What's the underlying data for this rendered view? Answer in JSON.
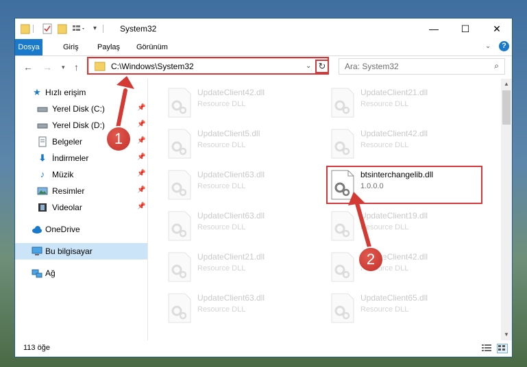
{
  "window": {
    "title": "System32"
  },
  "window_controls": {
    "minimize": "—",
    "maximize": "☐",
    "close": "✕"
  },
  "ribbon": {
    "tabs": [
      "Dosya",
      "Giriş",
      "Paylaş",
      "Görünüm"
    ]
  },
  "address": {
    "path": "C:\\Windows\\System32",
    "refresh": "↻"
  },
  "search": {
    "placeholder": "Ara: System32"
  },
  "sidebar": {
    "items": [
      {
        "label": "Hızlı erişim"
      },
      {
        "label": "Yerel Disk (C:)"
      },
      {
        "label": "Yerel Disk (D:)"
      },
      {
        "label": "Belgeler"
      },
      {
        "label": "İndirmeler"
      },
      {
        "label": "Müzik"
      },
      {
        "label": "Resimler"
      },
      {
        "label": "Videolar"
      },
      {
        "label": "OneDrive"
      },
      {
        "label": "Bu bilgisayar"
      },
      {
        "label": "Ağ"
      }
    ]
  },
  "files": [
    {
      "name": "UpdateClient42.dll",
      "desc": "Resource DLL"
    },
    {
      "name": "UpdateClient21.dll",
      "desc": "Resource DLL"
    },
    {
      "name": "UpdateClient5.dll",
      "desc": "Resource DLL"
    },
    {
      "name": "UpdateClient42.dll",
      "desc": "Resource DLL"
    },
    {
      "name": "UpdateClient63.dll",
      "desc": "Resource DLL"
    },
    {
      "name": "btsinterchangelib.dll",
      "desc": "1.0.0.0"
    },
    {
      "name": "UpdateClient63.dll",
      "desc": "Resource DLL"
    },
    {
      "name": "UpdateClient19.dll",
      "desc": "Resource DLL"
    },
    {
      "name": "UpdateClient21.dll",
      "desc": "Resource DLL"
    },
    {
      "name": "UpdateClient42.dll",
      "desc": "Resource DLL"
    },
    {
      "name": "UpdateClient63.dll",
      "desc": "Resource DLL"
    },
    {
      "name": "UpdateClient65.dll",
      "desc": "Resource DLL"
    }
  ],
  "status": {
    "count": "113 öğe"
  },
  "annotations": {
    "step1": "1",
    "step2": "2"
  },
  "colors": {
    "accent": "#1979ca",
    "highlight": "#d2373a",
    "selected": "#cce4f7"
  }
}
